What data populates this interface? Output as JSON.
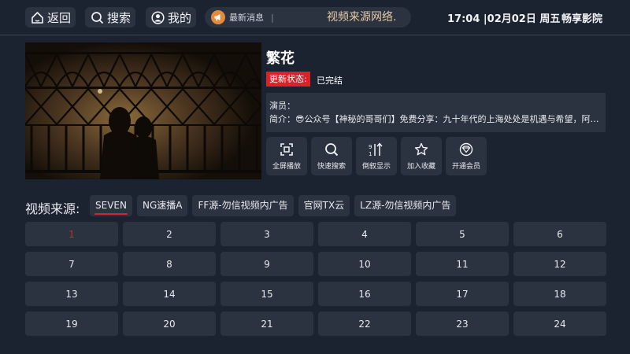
{
  "topbar": {
    "back_label": "返回",
    "search_label": "搜索",
    "mine_label": "我的",
    "news_label": "最新消息",
    "news_separator": "|",
    "news_marquee": "视频来源网络.",
    "datetime": "17:04 |02月02日 周五",
    "app_name": "畅享影院"
  },
  "detail": {
    "title": "繁花",
    "status_label": "更新状态:",
    "status_value": "已完结",
    "actors_line": "演员：",
    "intro_line": "简介：😎公众号【神秘的哥哥们】免费分享：九十年代的上海处处是机遇与希望，阿宝（胡歌饰）抓住时代机遇，从小瘪三逆袭为宝总"
  },
  "actions": [
    {
      "label": "全屏播放",
      "icon": "fullscreen-icon"
    },
    {
      "label": "快速搜索",
      "icon": "search-icon"
    },
    {
      "label": "倒叙显示",
      "icon": "sort-icon"
    },
    {
      "label": "加入收藏",
      "icon": "star-icon"
    },
    {
      "label": "开通会员",
      "icon": "vip-icon"
    }
  ],
  "sources": {
    "label": "视频来源:",
    "tabs": [
      "SEVEN",
      "NG速播A",
      "FF源-勿信视频内广告",
      "官网TX云",
      "LZ源-勿信视频内广告"
    ],
    "active_index": 0
  },
  "episodes": [
    "1",
    "2",
    "3",
    "4",
    "5",
    "6",
    "7",
    "8",
    "9",
    "10",
    "11",
    "12",
    "13",
    "14",
    "15",
    "16",
    "17",
    "18",
    "19",
    "20",
    "21",
    "22",
    "23",
    "24"
  ],
  "current_episode": "1",
  "colors": {
    "background": "#1b2230",
    "panel": "#2b3240",
    "accent_red": "#d8232a",
    "marquee": "#e6c9a5"
  }
}
